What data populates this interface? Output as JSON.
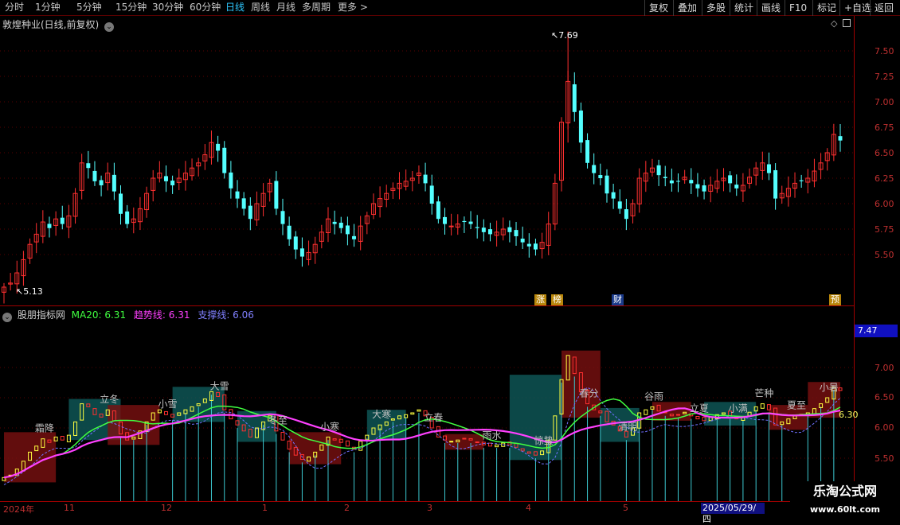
{
  "toolbar": {
    "periods": [
      "分时",
      "1分钟",
      "5分钟",
      "15分钟",
      "30分钟",
      "60分钟",
      "日线",
      "周线",
      "月线",
      "多周期",
      "更多 >"
    ],
    "active_period": "日线",
    "right_buttons": [
      "复权",
      "叠加",
      "多股",
      "统计",
      "画线",
      "F10",
      "标记",
      "+自选",
      "返回"
    ]
  },
  "main_chart": {
    "title": "敦煌种业(日线,前复权)",
    "high_label": "7.69",
    "low_label": "5.13",
    "y_ticks": [
      "7.50",
      "7.25",
      "7.00",
      "6.75",
      "6.50",
      "6.25",
      "6.00",
      "5.75",
      "5.50"
    ],
    "markers": [
      {
        "text": "涨",
        "bg": "#b8860b",
        "color": "#ffffff"
      },
      {
        "text": "榜",
        "bg": "#b8860b",
        "color": "#ffffff"
      },
      {
        "text": "财",
        "bg": "#1a3a8a",
        "color": "#ffffff"
      },
      {
        "text": "预",
        "bg": "#b8860b",
        "color": "#ffffff"
      }
    ]
  },
  "indicator": {
    "name": "股朋指标网",
    "items": [
      {
        "label": "MA20: 6.31",
        "color": "#40ff40"
      },
      {
        "label": "趋势线: 6.31",
        "color": "#ff40ff"
      },
      {
        "label": "支撑线: 6.06",
        "color": "#8080ff"
      }
    ],
    "value_box": "7.47",
    "last_value": "6.30",
    "y_ticks": [
      "7.00",
      "6.50",
      "6.00",
      "5.50"
    ],
    "terms": [
      "霜降",
      "立冬",
      "小雪",
      "大雪",
      "冬至",
      "小寒",
      "大寒",
      "立春",
      "雨水",
      "惊蛰",
      "春分",
      "清明",
      "谷雨",
      "立夏",
      "小满",
      "芒种",
      "夏至",
      "小暑"
    ]
  },
  "date_axis": {
    "labels": [
      "2024年",
      "11",
      "12",
      "1",
      "2",
      "3",
      "4",
      "5"
    ],
    "selected": "2025/05/29/四"
  },
  "watermark": {
    "line1": "乐淘公式网",
    "line2": "www.60lt.com"
  },
  "colors": {
    "up": "#ff3030",
    "down": "#54ffff",
    "border": "#a00000",
    "active_tab": "#2ec8ff"
  },
  "chart_data": {
    "type": "candlestick",
    "title": "敦煌种业(日线,前复权)",
    "x_range": [
      "2024-10",
      "2025-05-29"
    ],
    "ylim": [
      5.35,
      7.75
    ],
    "closes": [
      5.18,
      5.22,
      5.32,
      5.45,
      5.6,
      5.7,
      5.82,
      5.76,
      5.85,
      5.8,
      5.88,
      6.1,
      6.4,
      6.35,
      6.22,
      6.18,
      6.3,
      6.12,
      5.9,
      5.8,
      5.85,
      5.95,
      6.1,
      6.25,
      6.3,
      6.22,
      6.18,
      6.25,
      6.3,
      6.35,
      6.4,
      6.48,
      6.6,
      6.52,
      6.3,
      6.15,
      6.05,
      5.95,
      5.85,
      6.0,
      6.1,
      6.2,
      5.95,
      5.8,
      5.65,
      5.55,
      5.48,
      5.52,
      5.6,
      5.72,
      5.85,
      5.8,
      5.76,
      5.7,
      5.65,
      5.78,
      5.88,
      6.0,
      6.05,
      6.1,
      6.15,
      6.2,
      6.22,
      6.25,
      6.3,
      6.2,
      6.0,
      5.85,
      5.8,
      5.78,
      5.8,
      5.82,
      5.8,
      5.76,
      5.72,
      5.7,
      5.72,
      5.75,
      5.72,
      5.68,
      5.62,
      5.58,
      5.55,
      5.62,
      5.8,
      6.2,
      6.8,
      7.2,
      6.9,
      6.6,
      6.4,
      6.3,
      6.25,
      6.1,
      6.05,
      5.95,
      5.85,
      6.0,
      6.25,
      6.3,
      6.35,
      6.28,
      6.25,
      6.2,
      6.22,
      6.26,
      6.2,
      6.15,
      6.12,
      6.18,
      6.22,
      6.25,
      6.2,
      6.15,
      6.18,
      6.26,
      6.35,
      6.4,
      6.3,
      6.05,
      6.1,
      6.15,
      6.2,
      6.22,
      6.25,
      6.32,
      6.4,
      6.5,
      6.68,
      6.62
    ]
  }
}
